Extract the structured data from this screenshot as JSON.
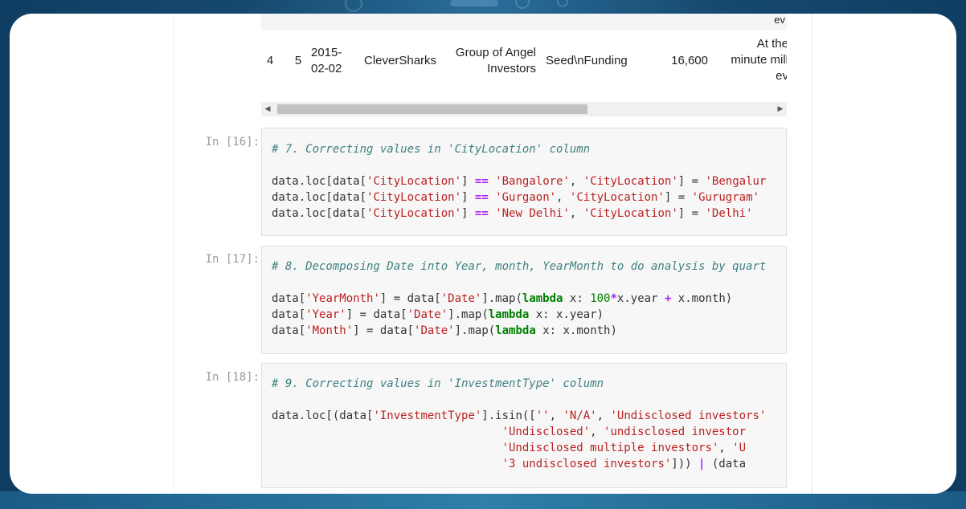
{
  "table": {
    "prev_row_tail": "ev",
    "row": {
      "index": "4",
      "sno": "5",
      "date_line1": "2015-",
      "date_line2": "02-02",
      "startup": "CleverSharks",
      "investors_line1": "Group of Angel",
      "investors_line2": "Investors",
      "investment_type": "Seed\\nFunding",
      "amount": "16,600",
      "remarks_line1": "At the",
      "remarks_line2": "minute mill",
      "remarks_line3": "ev"
    }
  },
  "scrollbar": {
    "left_arrow": "◀",
    "right_arrow": "▶"
  },
  "cells": [
    {
      "prompt": "In [16]:",
      "lines": [
        [
          {
            "t": "# 7. Correcting values in 'CityLocation' column",
            "c": "c"
          }
        ],
        [],
        [
          {
            "t": "data.loc[data[",
            "c": "p"
          },
          {
            "t": "'CityLocation'",
            "c": "s"
          },
          {
            "t": "] ",
            "c": "p"
          },
          {
            "t": "==",
            "c": "o"
          },
          {
            "t": " ",
            "c": "p"
          },
          {
            "t": "'Bangalore'",
            "c": "s"
          },
          {
            "t": ", ",
            "c": "p"
          },
          {
            "t": "'CityLocation'",
            "c": "s"
          },
          {
            "t": "] = ",
            "c": "p"
          },
          {
            "t": "'Bengalur",
            "c": "s"
          }
        ],
        [
          {
            "t": "data.loc[data[",
            "c": "p"
          },
          {
            "t": "'CityLocation'",
            "c": "s"
          },
          {
            "t": "] ",
            "c": "p"
          },
          {
            "t": "==",
            "c": "o"
          },
          {
            "t": " ",
            "c": "p"
          },
          {
            "t": "'Gurgaon'",
            "c": "s"
          },
          {
            "t": ", ",
            "c": "p"
          },
          {
            "t": "'CityLocation'",
            "c": "s"
          },
          {
            "t": "] = ",
            "c": "p"
          },
          {
            "t": "'Gurugram'",
            "c": "s"
          }
        ],
        [
          {
            "t": "data.loc[data[",
            "c": "p"
          },
          {
            "t": "'CityLocation'",
            "c": "s"
          },
          {
            "t": "] ",
            "c": "p"
          },
          {
            "t": "==",
            "c": "o"
          },
          {
            "t": " ",
            "c": "p"
          },
          {
            "t": "'New Delhi'",
            "c": "s"
          },
          {
            "t": ", ",
            "c": "p"
          },
          {
            "t": "'CityLocation'",
            "c": "s"
          },
          {
            "t": "] = ",
            "c": "p"
          },
          {
            "t": "'Delhi'",
            "c": "s"
          }
        ]
      ]
    },
    {
      "prompt": "In [17]:",
      "lines": [
        [
          {
            "t": "# 8. Decomposing Date into Year, month, YearMonth to do analysis by quart",
            "c": "c"
          }
        ],
        [],
        [
          {
            "t": "data[",
            "c": "p"
          },
          {
            "t": "'YearMonth'",
            "c": "s"
          },
          {
            "t": "] = data[",
            "c": "p"
          },
          {
            "t": "'Date'",
            "c": "s"
          },
          {
            "t": "].map(",
            "c": "p"
          },
          {
            "t": "lambda",
            "c": "k"
          },
          {
            "t": " x: ",
            "c": "p"
          },
          {
            "t": "100",
            "c": "n"
          },
          {
            "t": "*",
            "c": "o"
          },
          {
            "t": "x.year ",
            "c": "p"
          },
          {
            "t": "+",
            "c": "o"
          },
          {
            "t": " x.month)",
            "c": "p"
          }
        ],
        [
          {
            "t": "data[",
            "c": "p"
          },
          {
            "t": "'Year'",
            "c": "s"
          },
          {
            "t": "] = data[",
            "c": "p"
          },
          {
            "t": "'Date'",
            "c": "s"
          },
          {
            "t": "].map(",
            "c": "p"
          },
          {
            "t": "lambda",
            "c": "k"
          },
          {
            "t": " x: x.year)",
            "c": "p"
          }
        ],
        [
          {
            "t": "data[",
            "c": "p"
          },
          {
            "t": "'Month'",
            "c": "s"
          },
          {
            "t": "] = data[",
            "c": "p"
          },
          {
            "t": "'Date'",
            "c": "s"
          },
          {
            "t": "].map(",
            "c": "p"
          },
          {
            "t": "lambda",
            "c": "k"
          },
          {
            "t": " x: x.month)",
            "c": "p"
          }
        ]
      ]
    },
    {
      "prompt": "In [18]:",
      "lines": [
        [
          {
            "t": "# 9. Correcting values in 'InvestmentType' column",
            "c": "c"
          }
        ],
        [],
        [
          {
            "t": "data.loc[(data[",
            "c": "p"
          },
          {
            "t": "'InvestmentType'",
            "c": "s"
          },
          {
            "t": "].isin([",
            "c": "p"
          },
          {
            "t": "''",
            "c": "s"
          },
          {
            "t": ", ",
            "c": "p"
          },
          {
            "t": "'N/A'",
            "c": "s"
          },
          {
            "t": ", ",
            "c": "p"
          },
          {
            "t": "'Undisclosed investors'",
            "c": "s"
          }
        ],
        [
          {
            "t": "                                  ",
            "c": "p"
          },
          {
            "t": "'Undisclosed'",
            "c": "s"
          },
          {
            "t": ", ",
            "c": "p"
          },
          {
            "t": "'undisclosed investor",
            "c": "s"
          }
        ],
        [
          {
            "t": "                                  ",
            "c": "p"
          },
          {
            "t": "'Undisclosed multiple investors'",
            "c": "s"
          },
          {
            "t": ", ",
            "c": "p"
          },
          {
            "t": "'U",
            "c": "s"
          }
        ],
        [
          {
            "t": "                                  ",
            "c": "p"
          },
          {
            "t": "'3 undisclosed investors'",
            "c": "s"
          },
          {
            "t": "])) ",
            "c": "p"
          },
          {
            "t": "|",
            "c": "o"
          },
          {
            "t": " (data",
            "c": "p"
          }
        ]
      ]
    }
  ]
}
